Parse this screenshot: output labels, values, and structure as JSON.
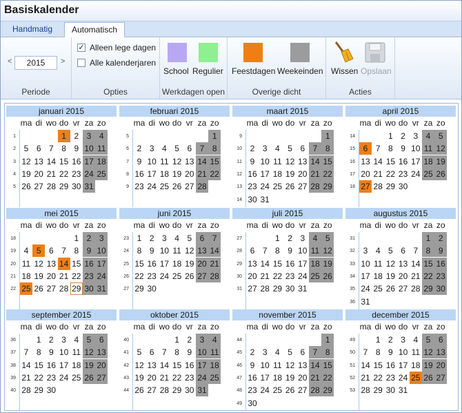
{
  "window": {
    "title": "Basiskalender"
  },
  "tabs": [
    {
      "label": "Handmatig"
    },
    {
      "label": "Automatisch"
    }
  ],
  "ribbon": {
    "periode": {
      "year": "2015",
      "prev": "<",
      "next": ">",
      "label": "Periode"
    },
    "opties": {
      "chk1": "Alleen lege dagen",
      "chk1_checked": "✓",
      "chk2": "Alle kalenderjaren",
      "label": "Opties"
    },
    "werkdagen": {
      "school": "School",
      "regulier": "Regulier",
      "label": "Werkdagen open",
      "school_color": "#b8a8f4",
      "regulier_color": "#8ef090"
    },
    "overige": {
      "feestdagen": "Feestdagen",
      "weekeinden": "Weekeinden",
      "label": "Overige dicht",
      "feest_color": "#ee7f18",
      "weekend_color": "#9c9c9c"
    },
    "acties": {
      "wissen": "Wissen",
      "opslaan": "Opslaan",
      "label": "Acties"
    }
  },
  "calendar": {
    "daynames": [
      "ma",
      "di",
      "wo",
      "do",
      "vr",
      "za",
      "zo"
    ],
    "months": [
      {
        "name": "januari 2015",
        "first": 3,
        "days": 31,
        "weeks": [
          "1",
          "2",
          "3",
          "4",
          "5"
        ],
        "holidays": [
          1
        ]
      },
      {
        "name": "februari 2015",
        "first": 6,
        "days": 28,
        "weeks": [
          "5",
          "6",
          "7",
          "8",
          "9"
        ],
        "holidays": []
      },
      {
        "name": "maart 2015",
        "first": 6,
        "days": 31,
        "weeks": [
          "9",
          "10",
          "11",
          "12",
          "13",
          "14"
        ],
        "holidays": []
      },
      {
        "name": "april 2015",
        "first": 2,
        "days": 30,
        "weeks": [
          "14",
          "15",
          "16",
          "17",
          "18"
        ],
        "holidays": [
          6,
          27
        ]
      },
      {
        "name": "mei 2015",
        "first": 4,
        "days": 31,
        "weeks": [
          "18",
          "19",
          "20",
          "21",
          "22"
        ],
        "holidays": [
          5,
          14,
          25
        ],
        "today": 29
      },
      {
        "name": "juni 2015",
        "first": 0,
        "days": 30,
        "weeks": [
          "23",
          "24",
          "25",
          "26",
          "27"
        ],
        "holidays": []
      },
      {
        "name": "juli 2015",
        "first": 2,
        "days": 31,
        "weeks": [
          "27",
          "28",
          "29",
          "30",
          "31"
        ],
        "holidays": []
      },
      {
        "name": "augustus 2015",
        "first": 5,
        "days": 31,
        "weeks": [
          "31",
          "32",
          "33",
          "34",
          "35",
          "36"
        ],
        "holidays": []
      },
      {
        "name": "september 2015",
        "first": 1,
        "days": 30,
        "weeks": [
          "36",
          "37",
          "38",
          "39",
          "40"
        ],
        "holidays": []
      },
      {
        "name": "oktober 2015",
        "first": 3,
        "days": 31,
        "weeks": [
          "40",
          "41",
          "42",
          "43",
          "44"
        ],
        "holidays": []
      },
      {
        "name": "november 2015",
        "first": 6,
        "days": 30,
        "weeks": [
          "44",
          "45",
          "46",
          "47",
          "48",
          "49"
        ],
        "holidays": []
      },
      {
        "name": "december 2015",
        "first": 1,
        "days": 31,
        "weeks": [
          "49",
          "50",
          "51",
          "52",
          "53"
        ],
        "holidays": [
          25
        ]
      }
    ]
  }
}
